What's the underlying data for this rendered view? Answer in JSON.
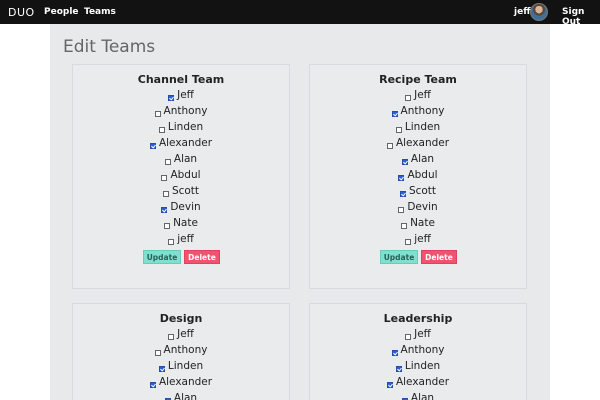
{
  "nav": {
    "brand": "DUO",
    "links": [
      "People",
      "Teams"
    ],
    "user": "jeff",
    "signout": "Sign Out"
  },
  "page": {
    "title": "Edit Teams"
  },
  "buttons": {
    "update": "Update",
    "delete": "Delete"
  },
  "teams": [
    {
      "name": "Channel Team",
      "members": [
        {
          "name": "Jeff",
          "checked": true
        },
        {
          "name": "Anthony",
          "checked": false
        },
        {
          "name": "Linden",
          "checked": false
        },
        {
          "name": "Alexander",
          "checked": true
        },
        {
          "name": "Alan",
          "checked": false
        },
        {
          "name": "Abdul",
          "checked": false
        },
        {
          "name": "Scott",
          "checked": false
        },
        {
          "name": "Devin",
          "checked": true
        },
        {
          "name": "Nate",
          "checked": false
        },
        {
          "name": "jeff",
          "checked": false
        }
      ]
    },
    {
      "name": "Recipe Team",
      "members": [
        {
          "name": "Jeff",
          "checked": false
        },
        {
          "name": "Anthony",
          "checked": true
        },
        {
          "name": "Linden",
          "checked": false
        },
        {
          "name": "Alexander",
          "checked": false
        },
        {
          "name": "Alan",
          "checked": true
        },
        {
          "name": "Abdul",
          "checked": true
        },
        {
          "name": "Scott",
          "checked": true
        },
        {
          "name": "Devin",
          "checked": false
        },
        {
          "name": "Nate",
          "checked": false
        },
        {
          "name": "jeff",
          "checked": false
        }
      ]
    },
    {
      "name": "Design",
      "members": [
        {
          "name": "Jeff",
          "checked": false
        },
        {
          "name": "Anthony",
          "checked": false
        },
        {
          "name": "Linden",
          "checked": true
        },
        {
          "name": "Alexander",
          "checked": true
        },
        {
          "name": "Alan",
          "checked": true
        }
      ]
    },
    {
      "name": "Leadership",
      "members": [
        {
          "name": "Jeff",
          "checked": false
        },
        {
          "name": "Anthony",
          "checked": true
        },
        {
          "name": "Linden",
          "checked": true
        },
        {
          "name": "Alexander",
          "checked": true
        },
        {
          "name": "Alan",
          "checked": true
        }
      ]
    }
  ]
}
